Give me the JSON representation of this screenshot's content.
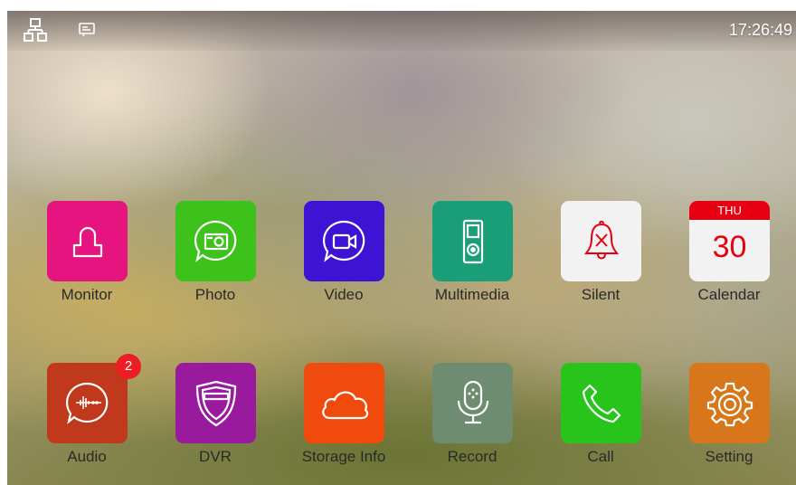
{
  "status_bar": {
    "time": "17:26:49",
    "icons": [
      "network-icon",
      "message-icon"
    ]
  },
  "apps_row1": [
    {
      "name": "monitor",
      "label": "Monitor",
      "color": "#e5147e",
      "icon": "person-icon"
    },
    {
      "name": "photo",
      "label": "Photo",
      "color": "#3dc21c",
      "icon": "photo-icon"
    },
    {
      "name": "video",
      "label": "Video",
      "color": "#3d14d4",
      "icon": "video-icon"
    },
    {
      "name": "multimedia",
      "label": "Multimedia",
      "color": "#1a9e78",
      "icon": "music-player-icon"
    },
    {
      "name": "silent",
      "label": "Silent",
      "color": "#f2f2f2",
      "icon": "bell-silent-icon"
    },
    {
      "name": "calendar",
      "label": "Calendar",
      "color": "#f2f2f2",
      "icon": "calendar-icon",
      "weekday": "THU",
      "day": "30"
    }
  ],
  "apps_row2": [
    {
      "name": "audio",
      "label": "Audio",
      "color": "#c0391c",
      "icon": "audio-message-icon",
      "badge": "2"
    },
    {
      "name": "dvr",
      "label": "DVR",
      "color": "#9a1a9e",
      "icon": "shield-icon"
    },
    {
      "name": "storage-info",
      "label": "Storage Info",
      "color": "#f04a0c",
      "icon": "cloud-icon"
    },
    {
      "name": "record",
      "label": "Record",
      "color": "#6e8c70",
      "icon": "microphone-icon"
    },
    {
      "name": "call",
      "label": "Call",
      "color": "#28c41c",
      "icon": "phone-icon"
    },
    {
      "name": "setting",
      "label": "Setting",
      "color": "#d7761a",
      "icon": "gear-icon"
    }
  ]
}
